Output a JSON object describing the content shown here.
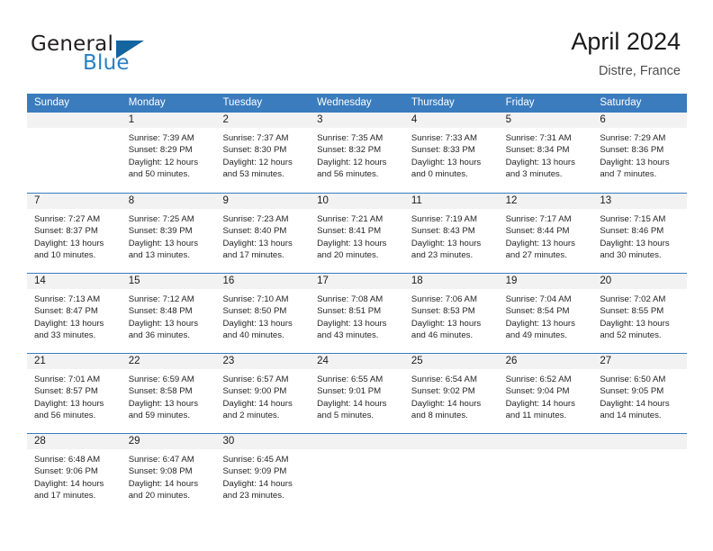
{
  "logo": {
    "word_top": "General",
    "word_bottom": "Blue",
    "triangle_color": "#1464a0",
    "blue_color": "#2980c4",
    "icon": "general-blue-logo"
  },
  "header": {
    "title": "April 2024",
    "subtitle": "Distre, France"
  },
  "theme": {
    "header_blue": "#3a7cbe",
    "daynum_band": "#f2f2f2",
    "text": "#262626"
  },
  "weekdays": [
    "Sunday",
    "Monday",
    "Tuesday",
    "Wednesday",
    "Thursday",
    "Friday",
    "Saturday"
  ],
  "weeks": [
    [
      {
        "day": ""
      },
      {
        "day": "1",
        "sunrise": "Sunrise: 7:39 AM",
        "sunset": "Sunset: 8:29 PM",
        "daylight1": "Daylight: 12 hours",
        "daylight2": "and 50 minutes."
      },
      {
        "day": "2",
        "sunrise": "Sunrise: 7:37 AM",
        "sunset": "Sunset: 8:30 PM",
        "daylight1": "Daylight: 12 hours",
        "daylight2": "and 53 minutes."
      },
      {
        "day": "3",
        "sunrise": "Sunrise: 7:35 AM",
        "sunset": "Sunset: 8:32 PM",
        "daylight1": "Daylight: 12 hours",
        "daylight2": "and 56 minutes."
      },
      {
        "day": "4",
        "sunrise": "Sunrise: 7:33 AM",
        "sunset": "Sunset: 8:33 PM",
        "daylight1": "Daylight: 13 hours",
        "daylight2": "and 0 minutes."
      },
      {
        "day": "5",
        "sunrise": "Sunrise: 7:31 AM",
        "sunset": "Sunset: 8:34 PM",
        "daylight1": "Daylight: 13 hours",
        "daylight2": "and 3 minutes."
      },
      {
        "day": "6",
        "sunrise": "Sunrise: 7:29 AM",
        "sunset": "Sunset: 8:36 PM",
        "daylight1": "Daylight: 13 hours",
        "daylight2": "and 7 minutes."
      }
    ],
    [
      {
        "day": "7",
        "sunrise": "Sunrise: 7:27 AM",
        "sunset": "Sunset: 8:37 PM",
        "daylight1": "Daylight: 13 hours",
        "daylight2": "and 10 minutes."
      },
      {
        "day": "8",
        "sunrise": "Sunrise: 7:25 AM",
        "sunset": "Sunset: 8:39 PM",
        "daylight1": "Daylight: 13 hours",
        "daylight2": "and 13 minutes."
      },
      {
        "day": "9",
        "sunrise": "Sunrise: 7:23 AM",
        "sunset": "Sunset: 8:40 PM",
        "daylight1": "Daylight: 13 hours",
        "daylight2": "and 17 minutes."
      },
      {
        "day": "10",
        "sunrise": "Sunrise: 7:21 AM",
        "sunset": "Sunset: 8:41 PM",
        "daylight1": "Daylight: 13 hours",
        "daylight2": "and 20 minutes."
      },
      {
        "day": "11",
        "sunrise": "Sunrise: 7:19 AM",
        "sunset": "Sunset: 8:43 PM",
        "daylight1": "Daylight: 13 hours",
        "daylight2": "and 23 minutes."
      },
      {
        "day": "12",
        "sunrise": "Sunrise: 7:17 AM",
        "sunset": "Sunset: 8:44 PM",
        "daylight1": "Daylight: 13 hours",
        "daylight2": "and 27 minutes."
      },
      {
        "day": "13",
        "sunrise": "Sunrise: 7:15 AM",
        "sunset": "Sunset: 8:46 PM",
        "daylight1": "Daylight: 13 hours",
        "daylight2": "and 30 minutes."
      }
    ],
    [
      {
        "day": "14",
        "sunrise": "Sunrise: 7:13 AM",
        "sunset": "Sunset: 8:47 PM",
        "daylight1": "Daylight: 13 hours",
        "daylight2": "and 33 minutes."
      },
      {
        "day": "15",
        "sunrise": "Sunrise: 7:12 AM",
        "sunset": "Sunset: 8:48 PM",
        "daylight1": "Daylight: 13 hours",
        "daylight2": "and 36 minutes."
      },
      {
        "day": "16",
        "sunrise": "Sunrise: 7:10 AM",
        "sunset": "Sunset: 8:50 PM",
        "daylight1": "Daylight: 13 hours",
        "daylight2": "and 40 minutes."
      },
      {
        "day": "17",
        "sunrise": "Sunrise: 7:08 AM",
        "sunset": "Sunset: 8:51 PM",
        "daylight1": "Daylight: 13 hours",
        "daylight2": "and 43 minutes."
      },
      {
        "day": "18",
        "sunrise": "Sunrise: 7:06 AM",
        "sunset": "Sunset: 8:53 PM",
        "daylight1": "Daylight: 13 hours",
        "daylight2": "and 46 minutes."
      },
      {
        "day": "19",
        "sunrise": "Sunrise: 7:04 AM",
        "sunset": "Sunset: 8:54 PM",
        "daylight1": "Daylight: 13 hours",
        "daylight2": "and 49 minutes."
      },
      {
        "day": "20",
        "sunrise": "Sunrise: 7:02 AM",
        "sunset": "Sunset: 8:55 PM",
        "daylight1": "Daylight: 13 hours",
        "daylight2": "and 52 minutes."
      }
    ],
    [
      {
        "day": "21",
        "sunrise": "Sunrise: 7:01 AM",
        "sunset": "Sunset: 8:57 PM",
        "daylight1": "Daylight: 13 hours",
        "daylight2": "and 56 minutes."
      },
      {
        "day": "22",
        "sunrise": "Sunrise: 6:59 AM",
        "sunset": "Sunset: 8:58 PM",
        "daylight1": "Daylight: 13 hours",
        "daylight2": "and 59 minutes."
      },
      {
        "day": "23",
        "sunrise": "Sunrise: 6:57 AM",
        "sunset": "Sunset: 9:00 PM",
        "daylight1": "Daylight: 14 hours",
        "daylight2": "and 2 minutes."
      },
      {
        "day": "24",
        "sunrise": "Sunrise: 6:55 AM",
        "sunset": "Sunset: 9:01 PM",
        "daylight1": "Daylight: 14 hours",
        "daylight2": "and 5 minutes."
      },
      {
        "day": "25",
        "sunrise": "Sunrise: 6:54 AM",
        "sunset": "Sunset: 9:02 PM",
        "daylight1": "Daylight: 14 hours",
        "daylight2": "and 8 minutes."
      },
      {
        "day": "26",
        "sunrise": "Sunrise: 6:52 AM",
        "sunset": "Sunset: 9:04 PM",
        "daylight1": "Daylight: 14 hours",
        "daylight2": "and 11 minutes."
      },
      {
        "day": "27",
        "sunrise": "Sunrise: 6:50 AM",
        "sunset": "Sunset: 9:05 PM",
        "daylight1": "Daylight: 14 hours",
        "daylight2": "and 14 minutes."
      }
    ],
    [
      {
        "day": "28",
        "sunrise": "Sunrise: 6:48 AM",
        "sunset": "Sunset: 9:06 PM",
        "daylight1": "Daylight: 14 hours",
        "daylight2": "and 17 minutes."
      },
      {
        "day": "29",
        "sunrise": "Sunrise: 6:47 AM",
        "sunset": "Sunset: 9:08 PM",
        "daylight1": "Daylight: 14 hours",
        "daylight2": "and 20 minutes."
      },
      {
        "day": "30",
        "sunrise": "Sunrise: 6:45 AM",
        "sunset": "Sunset: 9:09 PM",
        "daylight1": "Daylight: 14 hours",
        "daylight2": "and 23 minutes."
      },
      {
        "day": ""
      },
      {
        "day": ""
      },
      {
        "day": ""
      },
      {
        "day": ""
      }
    ]
  ]
}
